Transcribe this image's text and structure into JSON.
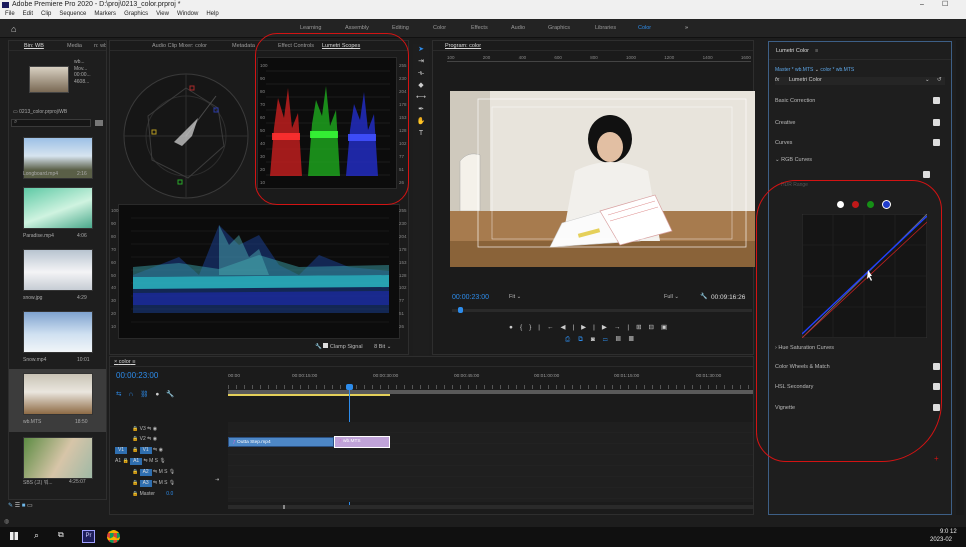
{
  "window": {
    "title": "Adobe Premiere Pro 2020 - D:\\proj\\0213_color.prproj *",
    "controls": [
      "–",
      "☐"
    ]
  },
  "menu": [
    "File",
    "Edit",
    "Clip",
    "Sequence",
    "Markers",
    "Graphics",
    "View",
    "Window",
    "Help"
  ],
  "workspaces": {
    "items": [
      "Learning",
      "Assembly",
      "Editing",
      "Color",
      "Effects",
      "Audio",
      "Graphics",
      "Libraries",
      "Color"
    ],
    "active_index": 8,
    "more": "»"
  },
  "project_panel": {
    "tabs": [
      "Bin: WB",
      "Media",
      "n: wb.MTS"
    ],
    "preview_lines": [
      "wb...",
      "Mov...",
      "00:00...",
      "4608..."
    ],
    "project_name": "0213_color.prproj\\WB",
    "items": [
      {
        "name": "Longboard.mp4",
        "duration": "2:16"
      },
      {
        "name": "Paradise.mp4",
        "duration": "4:06"
      },
      {
        "name": "snow.jpg",
        "duration": "4:29"
      },
      {
        "name": "Snow.mp4",
        "duration": "10:01"
      },
      {
        "name": "wb.MTS",
        "duration": "18:50"
      },
      {
        "name": "SBS (고) 뭐...",
        "duration": "4:25:07"
      }
    ]
  },
  "scopes_panel": {
    "tabs": [
      "Audio Clip Mixer: color",
      "Metadata",
      "Effect Controls",
      "Lumetri Scopes"
    ],
    "parade_scale": [
      "100",
      "90",
      "80",
      "70",
      "60",
      "50",
      "40",
      "30",
      "20",
      "10"
    ],
    "parade_scale_right": [
      "255",
      "230",
      "204",
      "178",
      "153",
      "128",
      "102",
      "77",
      "51",
      "26"
    ],
    "waveform_scale": [
      "100",
      "90",
      "80",
      "70",
      "60",
      "50",
      "40",
      "30",
      "20",
      "10"
    ],
    "waveform_scale_right": [
      "255",
      "230",
      "204",
      "178",
      "153",
      "128",
      "102",
      "77",
      "51",
      "26"
    ],
    "clamp_label": "Clamp Signal",
    "bit_depth": "8 Bit"
  },
  "program_monitor": {
    "title": "Program: color",
    "timecode": "00:00:23:00",
    "fit": "Fit",
    "quality": "Full",
    "duration": "00:09:16:26",
    "ruler": [
      "100",
      "200",
      "400",
      "600",
      "800",
      "1000",
      "1200",
      "1400",
      "1600"
    ]
  },
  "lumetri": {
    "title": "Lumetri Color",
    "master": "Master * wb.MTS",
    "clip": "color * wb.MTS",
    "fx": "fx",
    "effect": "Lumetri Color",
    "sections": [
      {
        "label": "Basic Correction",
        "checked": true
      },
      {
        "label": "Creative",
        "checked": true
      },
      {
        "label": "Curves",
        "checked": true
      },
      {
        "label": "Color Wheels & Match",
        "checked": true
      },
      {
        "label": "HSL Secondary",
        "checked": true
      },
      {
        "label": "Vignette",
        "checked": true
      }
    ],
    "rgb_curves": "RGB Curves",
    "hdr_range": "HDR Range",
    "hue_sat": "Hue Saturation Curves"
  },
  "timeline": {
    "title": "color",
    "timecode": "00:00:23:00",
    "ruler": [
      "00:00",
      "00:00:15:00",
      "00:00:30:00",
      "00:00:45:00",
      "00:01:00:00",
      "00:01:15:00",
      "00:01:30:00"
    ],
    "tracks": [
      "V3",
      "V2",
      "V1",
      "A1",
      "A2",
      "A3",
      "Master"
    ],
    "master_value": "0.0",
    "clips": [
      {
        "name": "Outta Step.mp4"
      },
      {
        "name": "wb.MTS"
      }
    ]
  },
  "taskbar": {
    "time": "9:0 12",
    "date": "2023-02"
  },
  "colors": {
    "annotation": "#d31313",
    "accent": "#2d8ceb",
    "clip_blue": "#4d87c6",
    "clip_pink": "#c0a3d8"
  }
}
